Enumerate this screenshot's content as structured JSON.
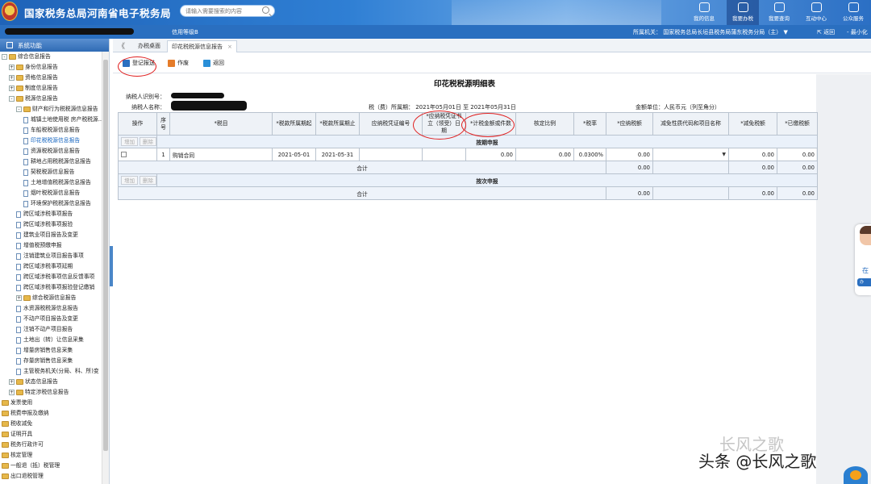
{
  "header": {
    "title": "国家税务总局河南省电子税务局",
    "search_placeholder": "请输入需要搜索的内容",
    "nav": [
      "我的信息",
      "我要办税",
      "我要查询",
      "互动中心",
      "公众服务"
    ],
    "active_nav": "我要办税"
  },
  "subbar": {
    "cert": "信用等级B",
    "org_label": "所属机关：",
    "org_value": "国家税务总局长垣县税务局蒲东税务分局（主）",
    "back": "返回",
    "min": "最小化"
  },
  "sidebar": {
    "title": "系统功能",
    "items": [
      {
        "label": "综合信息报告",
        "level": 0,
        "type": "folder",
        "toggle": "-"
      },
      {
        "label": "身份信息报告",
        "level": 1,
        "type": "folder",
        "toggle": "+"
      },
      {
        "label": "资格信息报告",
        "level": 1,
        "type": "folder",
        "toggle": "+"
      },
      {
        "label": "制度信息报告",
        "level": 1,
        "type": "folder",
        "toggle": "+"
      },
      {
        "label": "税源信息报告",
        "level": 1,
        "type": "folder",
        "toggle": "-"
      },
      {
        "label": "财产和行为税税源信息报告",
        "level": 2,
        "type": "folder",
        "toggle": "-"
      },
      {
        "label": "城镇土地使用税 房产税税源...",
        "level": 3,
        "type": "doc"
      },
      {
        "label": "车船税税源信息报告",
        "level": 3,
        "type": "doc"
      },
      {
        "label": "印花税税源信息报告",
        "level": 3,
        "type": "doc",
        "selected": true
      },
      {
        "label": "资源税税源信息报告",
        "level": 3,
        "type": "doc"
      },
      {
        "label": "耕地占用税税源信息报告",
        "level": 3,
        "type": "doc"
      },
      {
        "label": "契税税源信息报告",
        "level": 3,
        "type": "doc"
      },
      {
        "label": "土地增值税税源信息报告",
        "level": 3,
        "type": "doc"
      },
      {
        "label": "烟叶税税源信息报告",
        "level": 3,
        "type": "doc"
      },
      {
        "label": "环境保护税税源信息报告",
        "level": 3,
        "type": "doc"
      },
      {
        "label": "跨区域涉税事项报告",
        "level": 2,
        "type": "doc"
      },
      {
        "label": "跨区域涉税事项报验",
        "level": 2,
        "type": "doc"
      },
      {
        "label": "建筑业项目报告及变更",
        "level": 2,
        "type": "doc"
      },
      {
        "label": "增值税预缴申报",
        "level": 2,
        "type": "doc"
      },
      {
        "label": "注销建筑业项目报告事项",
        "level": 2,
        "type": "doc"
      },
      {
        "label": "跨区域涉税事项延期",
        "level": 2,
        "type": "doc"
      },
      {
        "label": "跨区域涉税事项信息反馈事项",
        "level": 2,
        "type": "doc"
      },
      {
        "label": "跨区域涉税事项报验登记缴销",
        "level": 2,
        "type": "doc"
      },
      {
        "label": "综合税源信息报告",
        "level": 2,
        "type": "folder",
        "toggle": "+"
      },
      {
        "label": "水资源税税源信息报告",
        "level": 2,
        "type": "doc"
      },
      {
        "label": "不动产项目报告及变更",
        "level": 2,
        "type": "doc"
      },
      {
        "label": "注销不动产项目报告",
        "level": 2,
        "type": "doc"
      },
      {
        "label": "土地出（转）让信息采集",
        "level": 2,
        "type": "doc"
      },
      {
        "label": "增量房销售信息采集",
        "level": 2,
        "type": "doc"
      },
      {
        "label": "存量房销售信息采集",
        "level": 2,
        "type": "doc"
      },
      {
        "label": "主管税务机关(分局、科、所)变",
        "level": 2,
        "type": "doc"
      },
      {
        "label": "状态信息报告",
        "level": 1,
        "type": "folder",
        "toggle": "+"
      },
      {
        "label": "特定涉税信息报告",
        "level": 1,
        "type": "folder",
        "toggle": "+"
      },
      {
        "label": "发票使用",
        "level": 0,
        "type": "folder"
      },
      {
        "label": "税费申报及缴纳",
        "level": 0,
        "type": "folder"
      },
      {
        "label": "税收减免",
        "level": 0,
        "type": "folder"
      },
      {
        "label": "证明开具",
        "level": 0,
        "type": "folder"
      },
      {
        "label": "税务行政许可",
        "level": 0,
        "type": "folder"
      },
      {
        "label": "核定管理",
        "level": 0,
        "type": "folder"
      },
      {
        "label": "一般退（抵）税管理",
        "level": 0,
        "type": "folder"
      },
      {
        "label": "出口退税管理",
        "level": 0,
        "type": "folder"
      }
    ]
  },
  "tabs": {
    "collapse": "《",
    "items": [
      "办税桌面",
      "印花税税源信息报告"
    ],
    "close": "×"
  },
  "toolbar": {
    "save": "登记报送",
    "void": "作废",
    "back": "返回"
  },
  "form": {
    "title": "印花税税源明细表",
    "taxpayer_id_label": "纳税人识别号：",
    "taxpayer_name_label": "纳税人名称：",
    "period": "税（费）所属期： 2021年05月01日 至 2021年05月31日",
    "unit": "金额单位：人民币元（列至角分）",
    "columns": [
      "操作",
      "序号",
      "*税目",
      "*税款所属期起",
      "*税款所属期止",
      "应纳税凭证编号",
      "*应纳税凭证书立（领受）日期",
      "*计税金额或件数",
      "核定比例",
      "*税率",
      "*应纳税额",
      "减免性质代码和项目名称",
      "*减免税额",
      "*已缴税额"
    ],
    "add": "增加",
    "delete": "删除",
    "section1": "按期申报",
    "row": {
      "seq": "1",
      "item": "购销合同",
      "start": "2021-05-01",
      "end": "2021-05-31",
      "voucher_no": "",
      "voucher_date": "",
      "amount": "0.00",
      "ratio": "0.00",
      "rate": "0.0300%",
      "tax": "0.00",
      "relief_code": "",
      "relief": "0.00",
      "paid": "0.00"
    },
    "subtotal": "合计",
    "sum1": {
      "tax": "0.00",
      "relief": "0.00",
      "paid": "0.00"
    },
    "section2": "按次申报",
    "sum2": {
      "tax": "0.00",
      "relief": "0.00",
      "paid": "0.00"
    }
  },
  "watermark": {
    "faint": "长风之歌",
    "main": "头条 @长风之歌"
  }
}
